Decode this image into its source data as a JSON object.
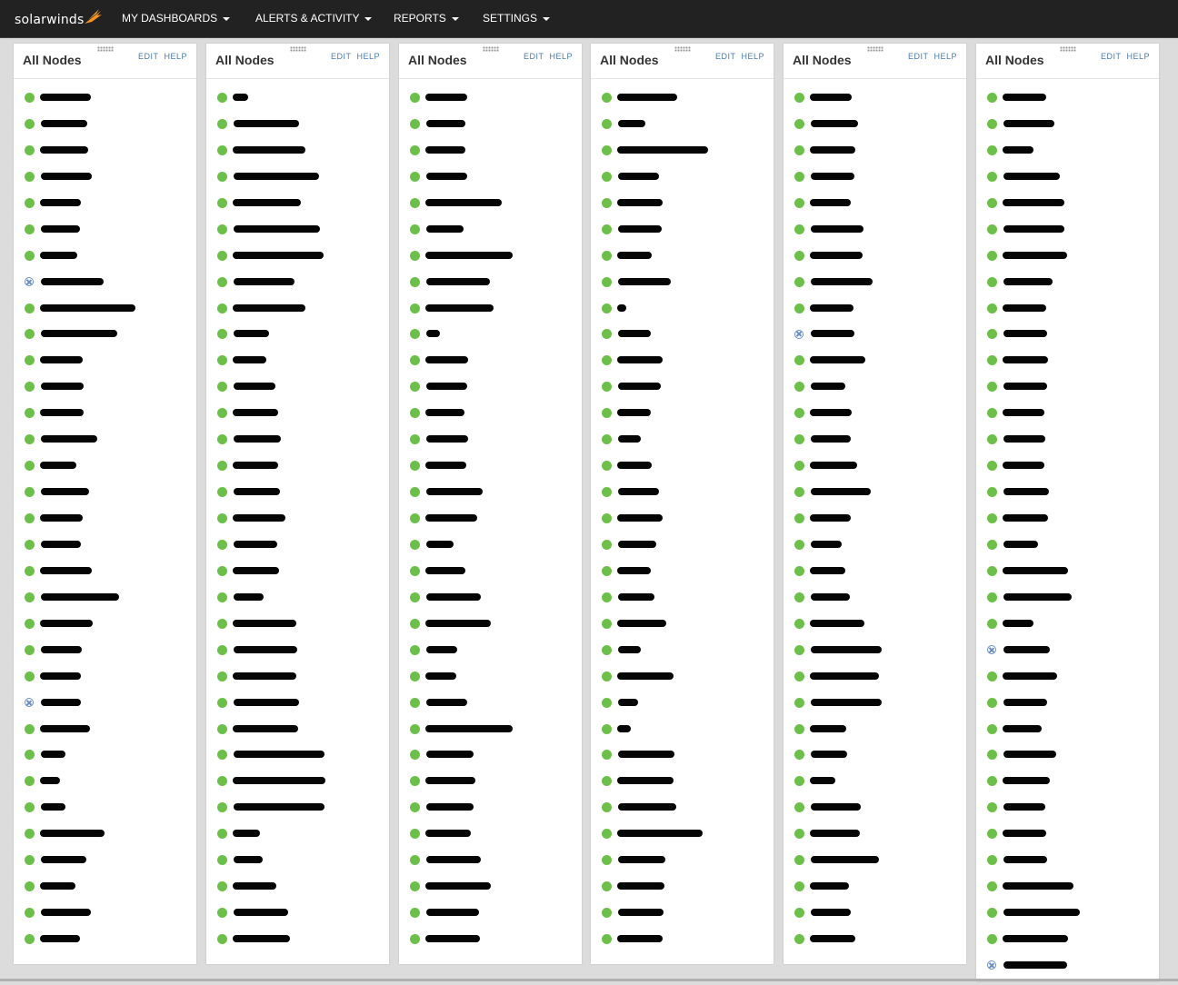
{
  "topbar": {
    "logo_text": "solarwinds",
    "menu": [
      "MY DASHBOARDS",
      "ALERTS & ACTIVITY",
      "REPORTS",
      "SETTINGS"
    ]
  },
  "panels": [
    {
      "title": "All Nodes",
      "edit": "EDIT",
      "help": "HELP",
      "statuses": [
        "up",
        "up",
        "up",
        "up",
        "up",
        "up",
        "up",
        "down",
        "up",
        "up",
        "up",
        "up",
        "up",
        "up",
        "up",
        "up",
        "up",
        "up",
        "up",
        "up",
        "up",
        "up",
        "up",
        "down",
        "up",
        "up",
        "up",
        "up",
        "up",
        "up",
        "up",
        "up",
        "up"
      ]
    },
    {
      "title": "All Nodes",
      "edit": "EDIT",
      "help": "HELP",
      "statuses": [
        "up",
        "up",
        "up",
        "up",
        "up",
        "up",
        "up",
        "up",
        "up",
        "up",
        "up",
        "up",
        "up",
        "up",
        "up",
        "up",
        "up",
        "up",
        "up",
        "up",
        "up",
        "up",
        "up",
        "up",
        "up",
        "up",
        "up",
        "up",
        "up",
        "up",
        "up",
        "up",
        "up"
      ]
    },
    {
      "title": "All Nodes",
      "edit": "EDIT",
      "help": "HELP",
      "statuses": [
        "up",
        "up",
        "up",
        "up",
        "up",
        "up",
        "up",
        "up",
        "up",
        "up",
        "up",
        "up",
        "up",
        "up",
        "up",
        "up",
        "up",
        "up",
        "up",
        "up",
        "up",
        "up",
        "up",
        "up",
        "up",
        "up",
        "up",
        "up",
        "up",
        "up",
        "up",
        "up",
        "up"
      ]
    },
    {
      "title": "All Nodes",
      "edit": "EDIT",
      "help": "HELP",
      "statuses": [
        "up",
        "up",
        "up",
        "up",
        "up",
        "up",
        "up",
        "up",
        "up",
        "up",
        "up",
        "up",
        "up",
        "up",
        "up",
        "up",
        "up",
        "up",
        "up",
        "up",
        "up",
        "up",
        "up",
        "up",
        "up",
        "up",
        "up",
        "up",
        "up",
        "up",
        "up",
        "up",
        "up"
      ]
    },
    {
      "title": "All Nodes",
      "edit": "EDIT",
      "help": "HELP",
      "statuses": [
        "up",
        "up",
        "up",
        "up",
        "up",
        "up",
        "up",
        "up",
        "up",
        "down",
        "up",
        "up",
        "up",
        "up",
        "up",
        "up",
        "up",
        "up",
        "up",
        "up",
        "up",
        "up",
        "up",
        "up",
        "up",
        "up",
        "up",
        "up",
        "up",
        "up",
        "up",
        "up",
        "up"
      ]
    },
    {
      "title": "All Nodes",
      "edit": "EDIT",
      "help": "HELP",
      "statuses": [
        "up",
        "up",
        "up",
        "up",
        "up",
        "up",
        "up",
        "up",
        "up",
        "up",
        "up",
        "up",
        "up",
        "up",
        "up",
        "up",
        "up",
        "up",
        "up",
        "up",
        "up",
        "down",
        "up",
        "up",
        "up",
        "up",
        "up",
        "up",
        "up",
        "up",
        "up",
        "up",
        "up",
        "down"
      ]
    }
  ],
  "colors": {
    "up": "#6cc04a",
    "down": "#6a8ec4",
    "link": "#4a7cb0",
    "topbar": "#222222"
  }
}
